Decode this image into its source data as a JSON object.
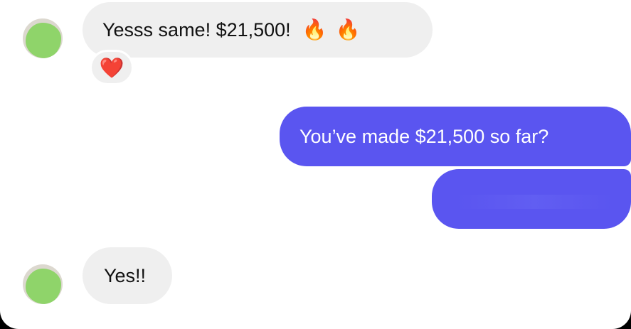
{
  "conversation": {
    "messages": [
      {
        "direction": "incoming",
        "text": "Yesss same! $21,500!",
        "emojis": [
          "🔥",
          "🔥"
        ],
        "reaction": "❤️"
      },
      {
        "direction": "outgoing",
        "text": "You’ve made $21,500 so far?"
      },
      {
        "direction": "outgoing",
        "text": "",
        "redacted": true
      },
      {
        "direction": "incoming",
        "text": "Yes!!"
      }
    ]
  },
  "colors": {
    "incoming_bubble": "#efefef",
    "outgoing_bubble": "#5a55f0",
    "avatar_censor": "#8fd46a",
    "reaction_heart": "#e2233b"
  },
  "icons": {
    "fire": "fire-emoji",
    "heart": "heart-reaction-icon"
  }
}
